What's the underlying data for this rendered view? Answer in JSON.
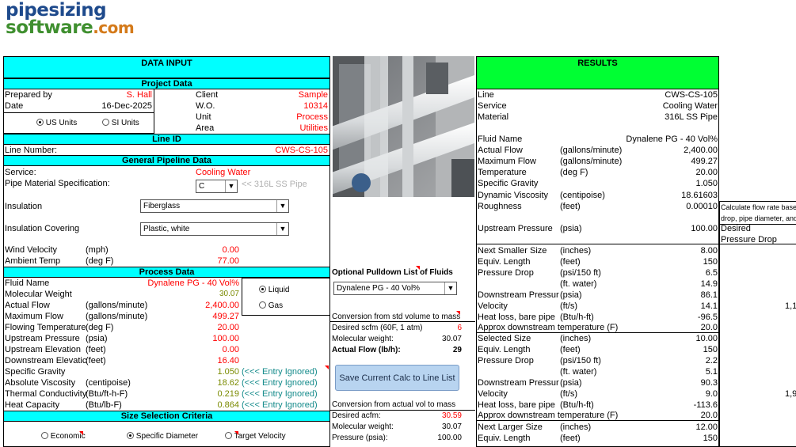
{
  "logo": {
    "line1": "pipesizing",
    "line2": "software",
    "line2_suffix": ".com"
  },
  "colors": {
    "input_header": "#00ffff",
    "results_header": "#00ff33",
    "value_red": "#ff0000"
  },
  "input": {
    "title": "DATA INPUT",
    "project": {
      "header": "Project Data",
      "prepared_by_label": "Prepared by",
      "prepared_by": "S. Hall",
      "date_label": "Date",
      "date": "16-Dec-2025",
      "client_label": "Client",
      "client": "Sample",
      "wo_label": "W.O.",
      "wo": "10314",
      "unit_label": "Unit",
      "unit": "Process",
      "area_label": "Area",
      "area": "Utilities",
      "us_units": "US Units",
      "si_units": "SI Units"
    },
    "line_id": {
      "header": "Line ID",
      "label": "Line Number:",
      "value": "CWS-CS-105"
    },
    "pipeline": {
      "header": "General Pipeline Data",
      "service_label": "Service:",
      "service": "Cooling Water",
      "material_label": "Pipe Material Specification:",
      "material_select": "C",
      "material_hint": "<< 316L SS Pipe",
      "insulation_label": "Insulation",
      "insulation": "Fiberglass",
      "covering_label": "Insulation Covering",
      "covering": "Plastic, white",
      "wind_label": "Wind Velocity",
      "wind_unit": "(mph)",
      "wind": "0.00",
      "ambient_label": "Ambient Temp",
      "ambient_unit": "(deg F)",
      "ambient": "77.00"
    },
    "process": {
      "header": "Process Data",
      "fluid_label": "Fluid Name",
      "fluid": "Dynalene PG - 40 Vol%",
      "mw_label": "Molecular Weight",
      "mw": "30.07",
      "actual_flow_label": "Actual Flow",
      "actual_flow_unit": "(gallons/minute)",
      "actual_flow": "2,400.00",
      "max_flow_label": "Maximum Flow",
      "max_flow_unit": "(gallons/minute)",
      "max_flow": "499.27",
      "temp_label": "Flowing Temperature",
      "temp_unit": "(deg F)",
      "temp": "20.00",
      "up_p_label": "Upstream Pressure",
      "up_p_unit": "(psia)",
      "up_p": "100.00",
      "up_elev_label": "Upstream Elevation",
      "up_elev_unit": "(feet)",
      "up_elev": "0.00",
      "down_elev_label": "Downstream Elevatic",
      "down_elev_unit": "(feet)",
      "down_elev": "16.40",
      "sg_label": "Specific Gravity",
      "sg": "1.050",
      "sg_note": "(<<< Entry Ignored)",
      "visc_label": "Absolute Viscosity",
      "visc_unit": "(centipoise)",
      "visc": "18.62",
      "visc_note": "(<<< Entry Ignored)",
      "tc_label": "Thermal Conductivity",
      "tc_unit": "(Btu/ft-h-F)",
      "tc": "0.219",
      "tc_note": "(<<< Entry Ignored)",
      "hc_label": "Heat Capacity",
      "hc_unit": "(Btu/lb-F)",
      "hc": "0.864",
      "hc_note": "(<<< Entry Ignored)",
      "liquid": "Liquid",
      "gas": "Gas"
    },
    "size": {
      "header": "Size Selection Criteria",
      "economic": "Economic",
      "specific": "Specific Diameter",
      "target": "Target Velocity"
    }
  },
  "middle": {
    "pulldown_title": "Optional Pulldown List of Fluids",
    "pulldown_value": "Dynalene PG - 40 Vol%",
    "std_title": "Conversion from std volume to mass",
    "scfm_label": "Desired scfm (60F, 1 atm)",
    "scfm": "6",
    "mw_label": "Molecular weight:",
    "mw": "30.07",
    "af_label": "Actual Flow (lb/h):",
    "af": "29",
    "save_button": "Save Current Calc to Line List",
    "act_title": "Conversion from actual vol to mass",
    "acfm_label": "Desired acfm:",
    "acfm": "30.59",
    "mw2_label": "Molecular weight:",
    "mw2": "30.07",
    "p_label": "Pressure (psia):",
    "p": "100.00"
  },
  "results": {
    "title": "RESULTS",
    "line_label": "Line",
    "line": "CWS-CS-105",
    "service_label": "Service",
    "service": "Cooling Water",
    "material_label": "Material",
    "material": "316L SS Pipe",
    "fluid_label": "Fluid Name",
    "fluid": "Dynalene PG - 40 Vol%",
    "af_label": "Actual Flow",
    "af_unit": "(gallons/minute)",
    "af": "2,400.00",
    "mf_label": "Maximum Flow",
    "mf_unit": "(gallons/minute)",
    "mf": "499.27",
    "t_label": "Temperature",
    "t_unit": "(deg F)",
    "t": "20.00",
    "sg_label": "Specific Gravity",
    "sg": "1.050",
    "dv_label": "Dynamic Viscosity",
    "dv_unit": "(centipoise)",
    "dv": "18.61603",
    "r_label": "Roughness",
    "r_unit": "(feet)",
    "r": "0.00010",
    "up_label": "Upstream Pressure",
    "up_unit": "(psia)",
    "up": "100.00",
    "smaller": {
      "size_label": "Next Smaller Size",
      "size_unit": "(inches)",
      "size": "8.00",
      "len_label": "Equiv. Length",
      "len_unit": "(feet)",
      "len": "150",
      "pd_label": "Pressure Drop",
      "pd_unit": "(psi/150 ft)",
      "pd": "6.5",
      "pdw_unit": "(ft. water)",
      "pdw": "14.9",
      "dp_label": "Downstream Pressur",
      "dp_unit": "(psia)",
      "dp": "86.1",
      "v_label": "Velocity",
      "v_unit": "(ft/s)",
      "v": "14.1",
      "hl_label": "Heat loss, bare pipe",
      "hl_unit": "(Btu/h-ft)",
      "hl": "-96.5",
      "adt_label": "Approx downstream temperature (F)",
      "adt": "20.0"
    },
    "selected": {
      "size_label": "Selected Size",
      "size_unit": "(inches)",
      "size": "10.00",
      "len_label": "Equiv. Length",
      "len_unit": "(feet)",
      "len": "150",
      "pd_label": "Pressure Drop",
      "pd_unit": "(psi/150 ft)",
      "pd": "2.2",
      "pdw_unit": "(ft. water)",
      "pdw": "5.1",
      "dp_label": "Downstream Pressur",
      "dp_unit": "(psia)",
      "dp": "90.3",
      "v_label": "Velocity",
      "v_unit": "(ft/s)",
      "v": "9.0",
      "hl_label": "Heat loss, bare pipe",
      "hl_unit": "(Btu/h-ft)",
      "hl": "-113.6",
      "adt_label": "Approx downstream temperature (F)",
      "adt": "20.0"
    },
    "larger": {
      "size_label": "Next Larger Size",
      "size_unit": "(inches)",
      "size": "12.00",
      "len_label": "Equiv. Length",
      "len_unit": "(feet)",
      "len": "150"
    }
  },
  "side": {
    "note1": "Calculate flow rate base",
    "note2": "drop, pipe diameter, and",
    "desired": "Desired",
    "pressure_drop": "Pressure Drop",
    "val1": "1,1",
    "val2": "1,9"
  }
}
